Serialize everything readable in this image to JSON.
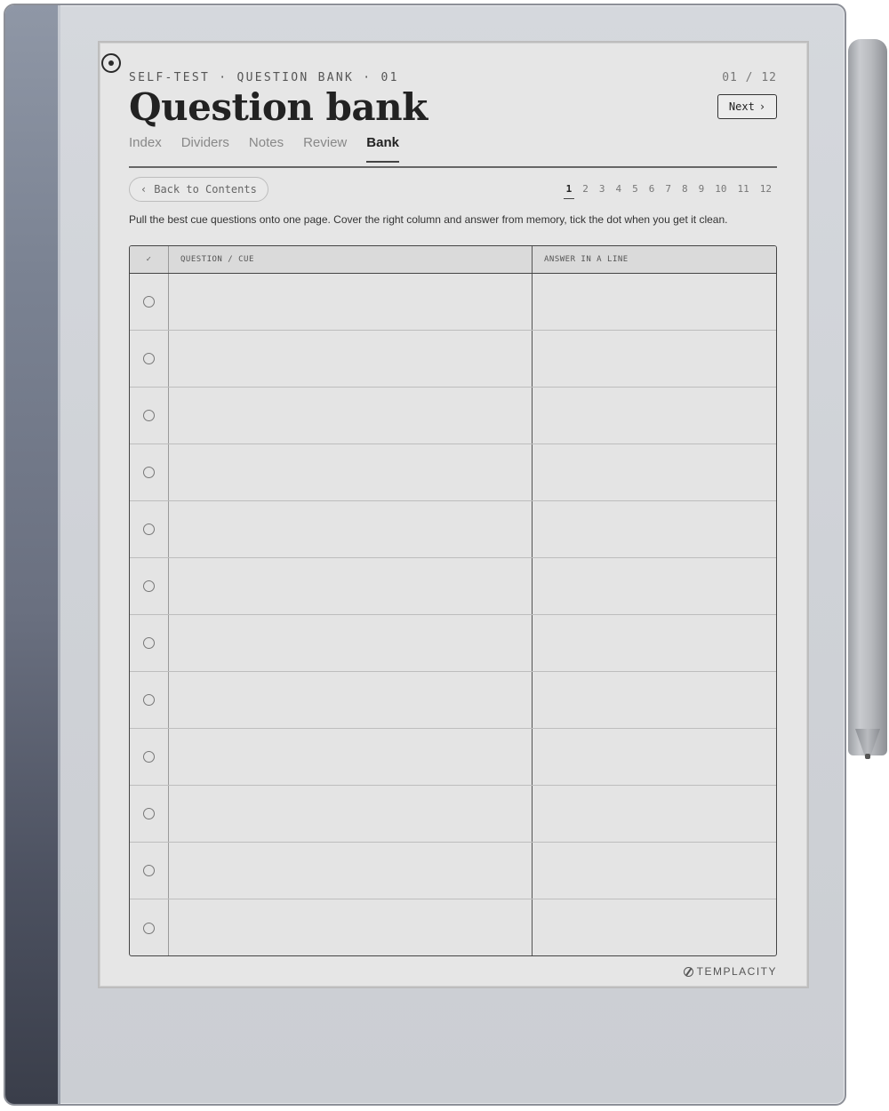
{
  "header": {
    "kicker": "SELF-TEST · QUESTION BANK · 01",
    "page_indicator": "01 / 12",
    "title": "Question bank",
    "next_label": "Next",
    "next_icon": "›"
  },
  "tabs": [
    {
      "label": "Index",
      "active": false
    },
    {
      "label": "Dividers",
      "active": false
    },
    {
      "label": "Notes",
      "active": false
    },
    {
      "label": "Review",
      "active": false
    },
    {
      "label": "Bank",
      "active": true
    }
  ],
  "back_button": {
    "icon": "‹",
    "label": "Back to Contents"
  },
  "pagination": {
    "pages": [
      "1",
      "2",
      "3",
      "4",
      "5",
      "6",
      "7",
      "8",
      "9",
      "10",
      "11",
      "12"
    ],
    "current": "1"
  },
  "instruction": "Pull the best cue questions onto one page. Cover the right column and answer from memory, tick the dot when you get it clean.",
  "table": {
    "headers": {
      "check": "✓",
      "question": "QUESTION / CUE",
      "answer": "ANSWER IN A LINE"
    },
    "row_count": 12
  },
  "brand": "TEMPLACITY",
  "colors": {
    "screen": "#e6e6e6",
    "spine": "#5f6573",
    "ink": "#222222"
  }
}
